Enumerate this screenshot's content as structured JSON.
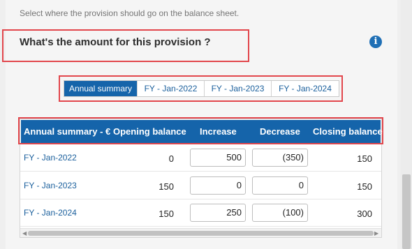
{
  "helper_text": "Select where the provision should go on the balance sheet.",
  "question": "What's the amount for this provision ?",
  "tabs": [
    {
      "label": "Annual summary",
      "active": true
    },
    {
      "label": "FY - Jan-2022",
      "active": false
    },
    {
      "label": "FY - Jan-2023",
      "active": false
    },
    {
      "label": "FY - Jan-2024",
      "active": false
    }
  ],
  "table": {
    "headers": [
      "Annual summary - €",
      "Opening balance",
      "Increase",
      "Decrease",
      "Closing balance"
    ],
    "rows": [
      {
        "period": "FY - Jan-2022",
        "opening": "0",
        "increase": "500",
        "decrease": "(350)",
        "closing": "150"
      },
      {
        "period": "FY - Jan-2023",
        "opening": "150",
        "increase": "0",
        "decrease": "0",
        "closing": "150"
      },
      {
        "period": "FY - Jan-2024",
        "opening": "150",
        "increase": "250",
        "decrease": "(100)",
        "closing": "300"
      }
    ]
  },
  "icons": {
    "info": "info-icon",
    "scroll_left": "arrow-left-icon",
    "scroll_right": "arrow-right-icon"
  },
  "colors": {
    "accent": "#1564aa",
    "highlight": "#e2464c"
  }
}
